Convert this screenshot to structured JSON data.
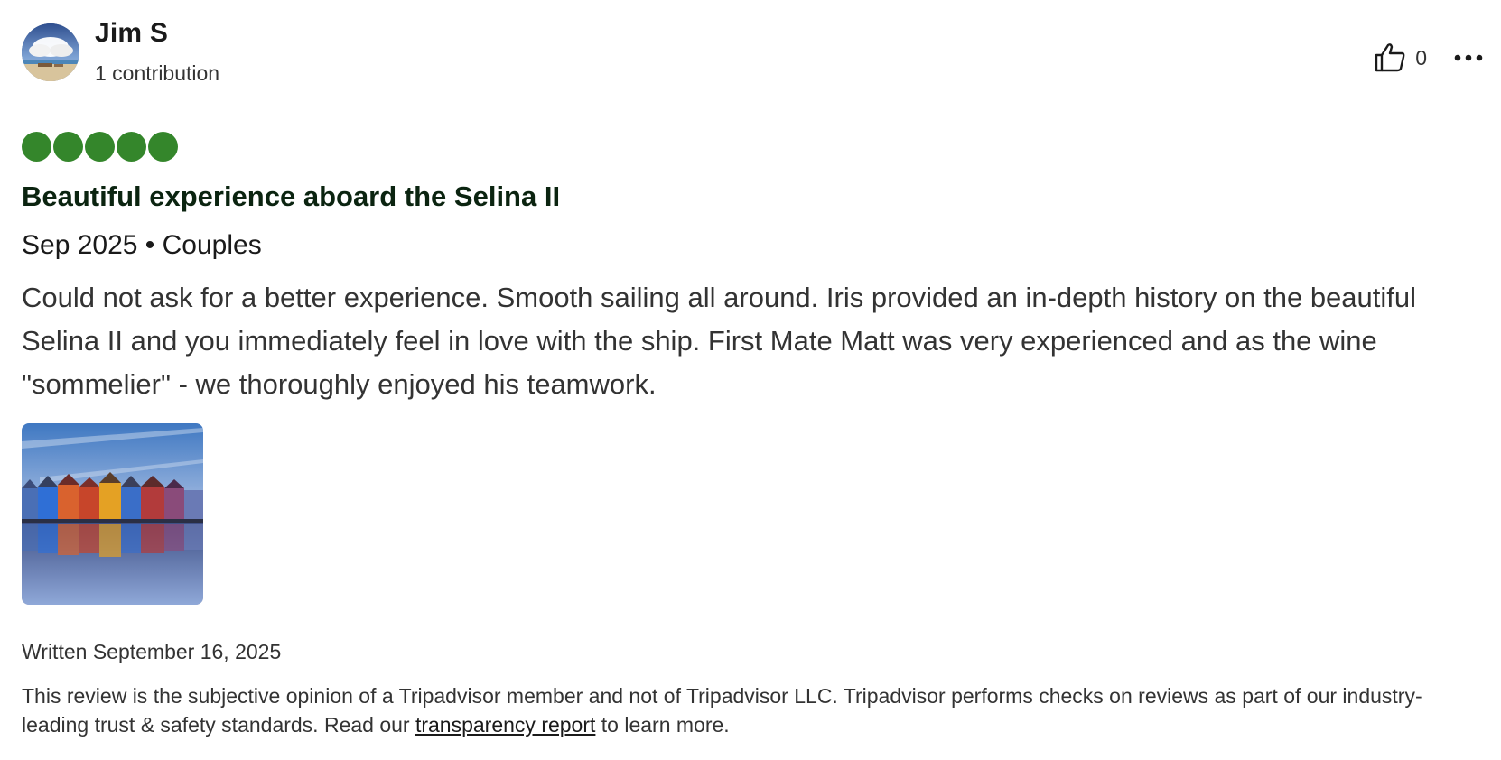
{
  "reviewer": {
    "name": "Jim S",
    "contributions": "1 contribution",
    "avatar_icon": "avatar-beach-photo"
  },
  "actions": {
    "helpful_icon": "thumbs-up-icon",
    "helpful_count": "0",
    "more_icon": "more-options-icon"
  },
  "rating": {
    "value": 5,
    "max": 5,
    "bubble_color": "#34862b"
  },
  "review": {
    "title": "Beautiful experience aboard the Selina II",
    "date_trip_type": "Sep 2025 • Couples",
    "text": "Could not ask for a better experience. Smooth sailing all around. Iris provided an in-depth history on the beautiful Selina II and you immediately feel in love with the ship. First Mate Matt was very experienced and as the wine \"sommelier\" - we thoroughly enjoyed his teamwork.",
    "photo_icon": "colorful-waterfront-houses-photo",
    "written": "Written September 16, 2025"
  },
  "disclaimer": {
    "text_before": "This review is the subjective opinion of a Tripadvisor member and not of Tripadvisor LLC. Tripadvisor performs checks on reviews as part of our industry-leading trust & safety standards. Read our ",
    "link_text": "transparency report",
    "text_after": " to learn more."
  }
}
